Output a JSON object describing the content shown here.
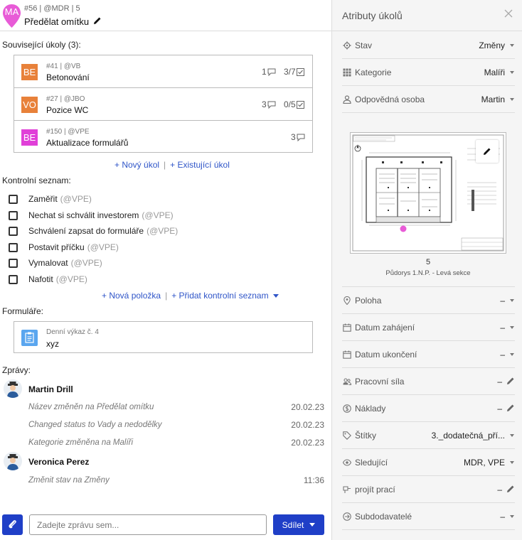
{
  "task": {
    "avatar_initials": "MA",
    "meta": "#56 | @MDR | 5",
    "title": "Předělat omítku"
  },
  "related": {
    "label": "Související úkoly (3):",
    "items": [
      {
        "badge": "BE",
        "badge_color": "#e8813a",
        "meta": "#41 | @VB",
        "title": "Betonování",
        "comments": "1",
        "checks": "3/7"
      },
      {
        "badge": "VO",
        "badge_color": "#e8813a",
        "meta": "#27 | @JBO",
        "title": "Pozice WC",
        "comments": "3",
        "checks": "0/5"
      },
      {
        "badge": "BE",
        "badge_color": "#e040d8",
        "meta": "#150 | @VPE",
        "title": "Aktualizace formulářů",
        "comments": "3",
        "checks": ""
      }
    ],
    "new_task": "+ Nový úkol",
    "existing_task": "+ Existující úkol"
  },
  "checklist": {
    "label": "Kontrolní seznam:",
    "items": [
      {
        "text": "Zaměřit",
        "who": "(@VPE)"
      },
      {
        "text": "Nechat si schválit investorem",
        "who": "(@VPE)"
      },
      {
        "text": "Schválení zapsat do formuláře",
        "who": "(@VPE)"
      },
      {
        "text": "Postavit příčku",
        "who": "(@VPE)"
      },
      {
        "text": "Vymalovat",
        "who": "(@VPE)"
      },
      {
        "text": "Nafotit",
        "who": "(@VPE)"
      }
    ],
    "new_item": "+ Nová položka",
    "add_list": "+ Přidat kontrolní seznam"
  },
  "forms": {
    "label": "Formuláře:",
    "item_meta": "Denní výkaz č. 4",
    "item_title": "xyz"
  },
  "messages": {
    "label": "Zprávy:",
    "groups": [
      {
        "author": "Martin Drill",
        "lines": [
          {
            "text": "Název změněn na Předělat omítku",
            "date": "20.02.23"
          },
          {
            "text": "Changed status to Vady a nedodělky",
            "date": "20.02.23"
          },
          {
            "text": "Kategorie změněna na Malíři",
            "date": "20.02.23"
          }
        ]
      },
      {
        "author": "Veronica Perez",
        "lines": [
          {
            "text": "Změnit stav na Změny",
            "date": "11:36"
          }
        ]
      }
    ]
  },
  "composer": {
    "placeholder": "Zadejte zprávu sem...",
    "share_label": "Sdílet"
  },
  "panel": {
    "title": "Atributy úkolů",
    "attrs_top": [
      {
        "icon": "gear-icon",
        "label": "Stav",
        "value": "Změny"
      },
      {
        "icon": "grid-icon",
        "label": "Kategorie",
        "value": "Malíři"
      },
      {
        "icon": "person-icon",
        "label": "Odpovědná osoba",
        "value": "Martin"
      }
    ],
    "plan_number": "5",
    "plan_name": "Půdorys 1.N.P. - Levá sekce",
    "attrs_bottom": [
      {
        "icon": "location-icon",
        "label": "Poloha",
        "value": "–",
        "control": "dropdown"
      },
      {
        "icon": "calendar-icon",
        "label": "Datum zahájení",
        "value": "–",
        "control": "dropdown"
      },
      {
        "icon": "calendar-icon",
        "label": "Datum ukončení",
        "value": "–",
        "control": "dropdown"
      },
      {
        "icon": "group-icon",
        "label": "Pracovní síla",
        "value": "–",
        "control": "edit"
      },
      {
        "icon": "dollar-icon",
        "label": "Náklady",
        "value": "–",
        "control": "edit"
      },
      {
        "icon": "tag-icon",
        "label": "Štítky",
        "value": "3._dodatečná_pří...",
        "control": "dropdown"
      },
      {
        "icon": "eye-icon",
        "label": "Sledující",
        "value": "MDR, VPE",
        "control": "dropdown"
      },
      {
        "icon": "work-icon",
        "label": "projít prací",
        "value": "–",
        "control": "edit"
      },
      {
        "icon": "subcontractor-icon",
        "label": "Subdodavatelé",
        "value": "–",
        "control": "dropdown"
      }
    ]
  },
  "colors": {
    "accent": "#1f3fc7",
    "link": "#2f55c8",
    "pin": "#e85bd7"
  }
}
